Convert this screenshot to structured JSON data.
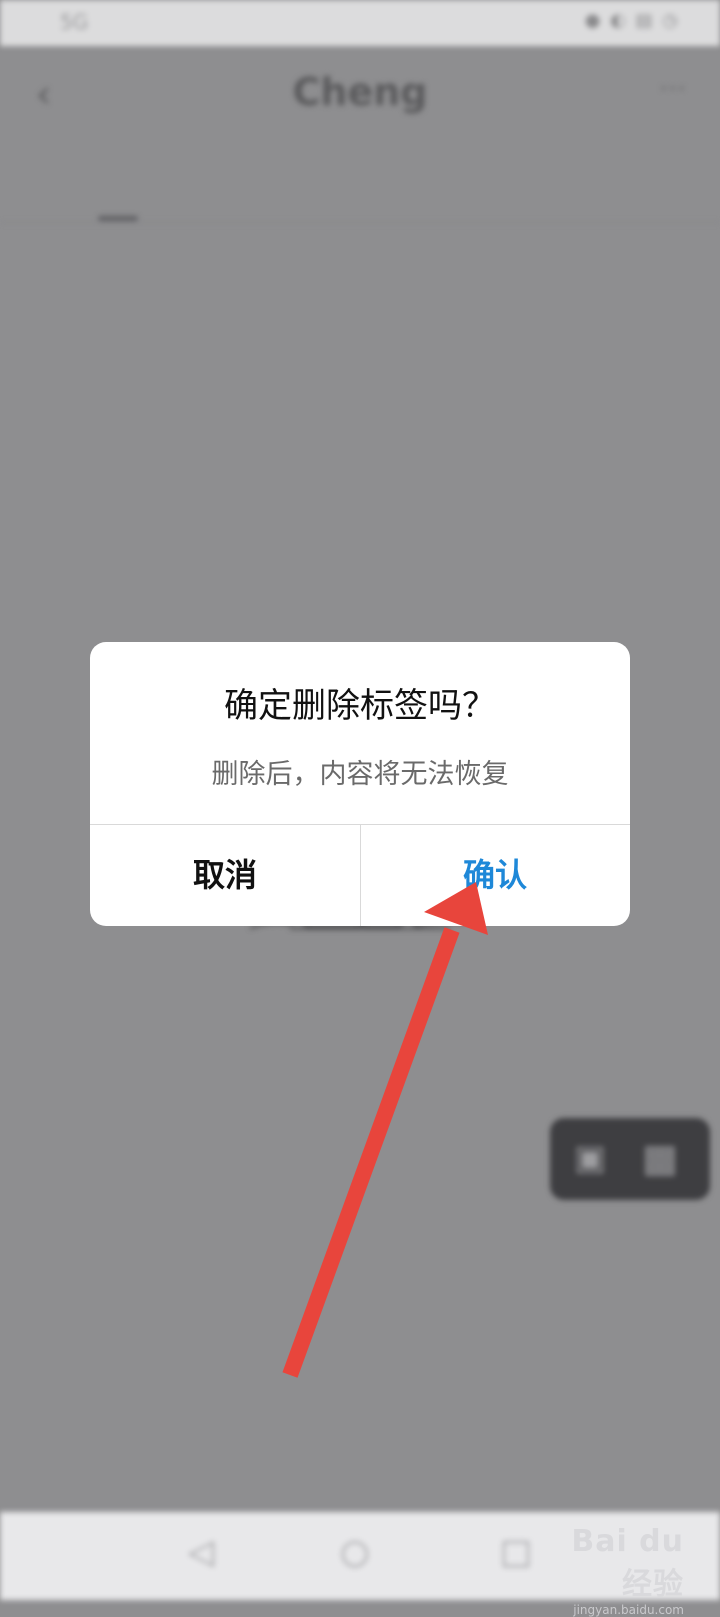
{
  "status_bar": {
    "left_text": "5G",
    "right_text": "● ◐ ▤ ◷"
  },
  "header": {
    "back_icon": "chevron-left-icon",
    "title": "Cheng",
    "more_icon": "more-icon"
  },
  "tabs": [
    {
      "label": "",
      "active": true
    },
    {
      "label": "",
      "active": false
    },
    {
      "label": "",
      "active": false
    }
  ],
  "empty_state": {
    "title": "",
    "description": ""
  },
  "floating_button": {
    "icons": [
      "grid-icon",
      "qr-icon"
    ]
  },
  "dialog": {
    "title": "确定删除标签吗？",
    "message": "删除后，内容将无法恢复",
    "cancel_label": "取消",
    "confirm_label": "确认",
    "confirm_color": "#1e88d8"
  },
  "annotation": {
    "arrow_color": "#e8453c"
  },
  "watermark": {
    "logo": "Bai du 经验",
    "url": "jingyan.baidu.com"
  },
  "nav_bar": {
    "icons": [
      "nav-back-icon",
      "nav-home-icon",
      "nav-recent-icon"
    ]
  }
}
